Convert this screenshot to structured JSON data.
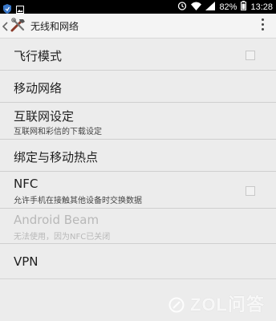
{
  "status_bar": {
    "battery": "82%",
    "time": "13:28",
    "icons": [
      "shield-icon",
      "image-icon",
      "alarm-icon",
      "wifi-icon",
      "signal-icon",
      "battery-icon"
    ]
  },
  "action_bar": {
    "title": "无线和网络",
    "icons": [
      "back-chevron-icon",
      "tools-icon",
      "overflow-menu-icon"
    ]
  },
  "settings": {
    "airplane": {
      "label": "飞行模式",
      "checked": false
    },
    "mobile_network": {
      "label": "移动网络"
    },
    "internet": {
      "label": "互联网设定",
      "summary": "互联网和彩信的下载设定"
    },
    "tethering": {
      "label": "绑定与移动热点"
    },
    "nfc": {
      "label": "NFC",
      "summary": "允许手机在接触其他设备时交换数据",
      "checked": false
    },
    "android_beam": {
      "label": "Android Beam",
      "summary": "无法使用，因为NFC已关闭",
      "enabled": false
    },
    "vpn": {
      "label": "VPN"
    }
  },
  "watermark": {
    "text": "ZOL问答"
  },
  "colors": {
    "background": "#ececec",
    "status_bar": "#000000",
    "divider": "#cfcfcf",
    "disabled_text": "#b8b8b8"
  }
}
